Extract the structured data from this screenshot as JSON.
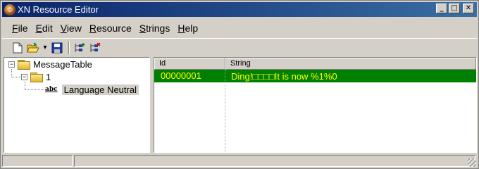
{
  "window": {
    "title": "XN Resource Editor",
    "minimize_glyph": "_",
    "maximize_glyph": "□",
    "close_glyph": "✕"
  },
  "menu": {
    "items": [
      {
        "accel": "F",
        "rest": "ile"
      },
      {
        "accel": "E",
        "rest": "dit"
      },
      {
        "accel": "V",
        "rest": "iew"
      },
      {
        "accel": "R",
        "rest": "esource"
      },
      {
        "accel": "S",
        "rest": "trings"
      },
      {
        "accel": "H",
        "rest": "elp"
      }
    ]
  },
  "toolbar": {
    "icons": [
      "new-file-icon",
      "open-folder-icon",
      "dropdown-arrow-icon",
      "save-icon",
      "add-resource-icon",
      "delete-resource-icon"
    ],
    "dropdown_glyph": "▾"
  },
  "tree": {
    "root": {
      "label": "MessageTable",
      "expander": "−"
    },
    "child": {
      "label": "1",
      "expander": "−"
    },
    "leaf": {
      "label": "Language Neutral",
      "icon_text": "abc"
    }
  },
  "table": {
    "columns": [
      "Id",
      "String"
    ],
    "rows": [
      {
        "id": "00000001",
        "string": "Ding!□□□□It is now %1%0"
      }
    ],
    "row_background": "#008000",
    "row_text_color": "#ffff00"
  },
  "colors": {
    "titlebar_start": "#0a246a",
    "titlebar_end": "#3a6ea5",
    "face": "#d4d0c8"
  }
}
